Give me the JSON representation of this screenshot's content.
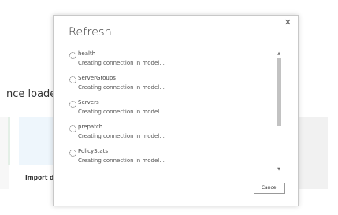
{
  "background": {
    "heading": "nce loade",
    "card_label": "Import da"
  },
  "dialog": {
    "title": "Refresh",
    "close_icon": "close-icon",
    "items": [
      {
        "name": "health",
        "status": "Creating connection in model..."
      },
      {
        "name": "ServerGroups",
        "status": "Creating connection in model..."
      },
      {
        "name": "Servers",
        "status": "Creating connection in model..."
      },
      {
        "name": "prepatch",
        "status": "Creating connection in model..."
      },
      {
        "name": "PolicyStats",
        "status": "Creating connection in model..."
      }
    ],
    "cancel_label": "Cancel"
  }
}
